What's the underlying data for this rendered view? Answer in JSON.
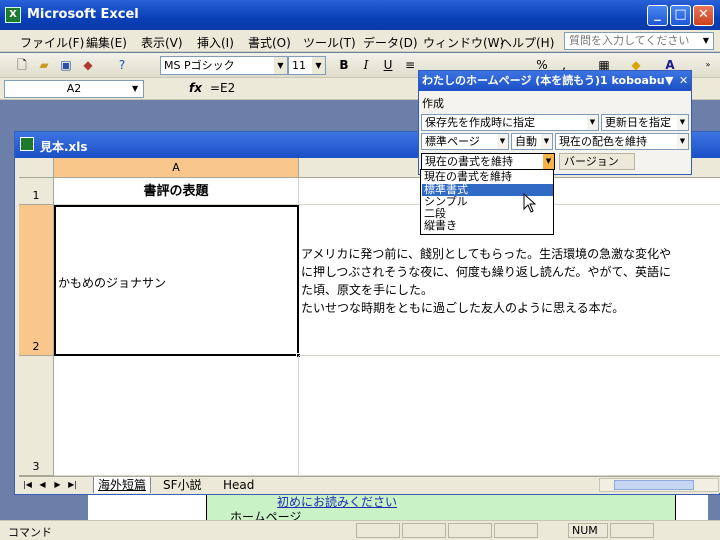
{
  "app": {
    "title": "Microsoft Excel",
    "icon_label": "X"
  },
  "window_controls": {
    "minimize": "_",
    "maximize": "□",
    "close": "✕"
  },
  "menu": {
    "items": [
      "ファイル(F)",
      "編集(E)",
      "表示(V)",
      "挿入(I)",
      "書式(O)",
      "ツール(T)",
      "データ(D)",
      "ウィンドウ(W)",
      "ヘルプ(H)"
    ],
    "help_placeholder": "質問を入力してください"
  },
  "toolbar": {
    "font_name": "MS Pゴシック",
    "font_size": "11",
    "bold": "B",
    "italic": "I",
    "underline": "U",
    "percent": "%",
    "font_color": "A"
  },
  "formula_bar": {
    "name_box": "A2",
    "fx": "fx",
    "formula": "=E2"
  },
  "workbook": {
    "title": "見本.xls",
    "columns": [
      "A"
    ],
    "rows": [
      "1",
      "2",
      "3"
    ],
    "cells": {
      "A1": "書評の表題",
      "A2": "かもめのジョナサン",
      "B2_lines": [
        "アメリカに発つ前に、餞別としてもらった。生活環境の急激な変化や",
        "に押しつぶされそうな夜に、何度も繰り返し読んだ。やがて、英語に",
        "た頃、原文を手にした。",
        "たいせつな時期をともに過ごした友人のように思える本だ。"
      ]
    },
    "sheets": [
      "海外短篇",
      "SF小説",
      "Head"
    ],
    "active_sheet": 0
  },
  "background_page": {
    "link_text": "初めにお読みください",
    "text2": "ホームページ"
  },
  "statusbar": {
    "text": "コマンド",
    "num": "NUM"
  },
  "floating_toolbar": {
    "title": "わたしのホームページ (本を読もう)1 koboabu",
    "section": "作成",
    "save_location": "保存先を作成時に指定",
    "update_date": "更新日を指定",
    "page_type": "標準ページ",
    "auto": "自動",
    "color_scheme": "現在の配色を維持",
    "format": "現在の書式を維持",
    "version": "バージョン"
  },
  "dropdown": {
    "items": [
      "現在の書式を維持",
      "標準書式",
      "シンプル",
      "二段",
      "縦書き"
    ],
    "highlighted": 1
  }
}
